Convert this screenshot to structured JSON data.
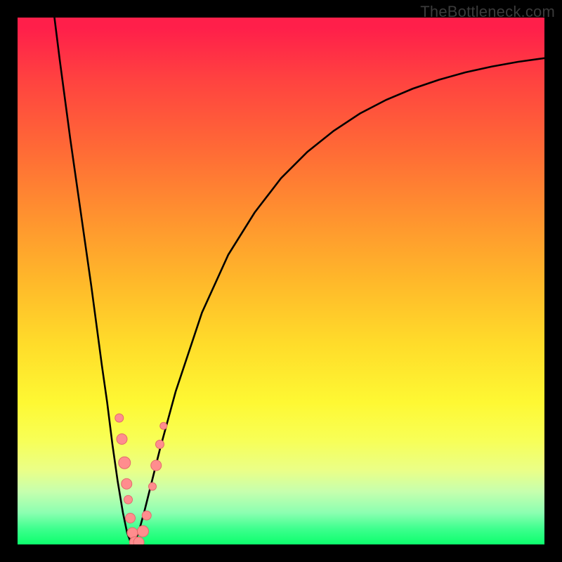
{
  "watermark": "TheBottleneck.com",
  "colors": {
    "curve": "#000000",
    "marker_fill": "#ff8d8e",
    "marker_stroke": "#e26b6b",
    "frame": "#000000"
  },
  "chart_data": {
    "type": "line",
    "title": "",
    "xlabel": "",
    "ylabel": "",
    "xlim": [
      0,
      100
    ],
    "ylim": [
      0,
      100
    ],
    "grid": false,
    "legend": false,
    "series": [
      {
        "name": "left-branch",
        "x": [
          7,
          8,
          10,
          12,
          14,
          16,
          17,
          18,
          19,
          20,
          20.8,
          21.4,
          22
        ],
        "y": [
          100,
          92,
          77,
          63,
          49,
          34,
          27,
          19,
          12,
          6,
          2.2,
          0.6,
          0
        ]
      },
      {
        "name": "right-branch",
        "x": [
          22,
          23,
          24,
          25,
          27,
          30,
          35,
          40,
          45,
          50,
          55,
          60,
          65,
          70,
          75,
          80,
          85,
          90,
          95,
          100
        ],
        "y": [
          0,
          2.4,
          6,
          10,
          18,
          29,
          44,
          55,
          63,
          69.5,
          74.5,
          78.5,
          81.8,
          84.4,
          86.5,
          88.2,
          89.6,
          90.7,
          91.6,
          92.3
        ]
      }
    ],
    "markers": {
      "name": "highlighted-points",
      "points": [
        {
          "x": 19.3,
          "y": 24.0,
          "r": 6.0
        },
        {
          "x": 19.8,
          "y": 20.0,
          "r": 7.5
        },
        {
          "x": 20.3,
          "y": 15.5,
          "r": 8.5
        },
        {
          "x": 20.7,
          "y": 11.5,
          "r": 7.5
        },
        {
          "x": 21.0,
          "y": 8.5,
          "r": 6.0
        },
        {
          "x": 21.4,
          "y": 5.0,
          "r": 7.0
        },
        {
          "x": 21.8,
          "y": 2.2,
          "r": 7.5
        },
        {
          "x": 22.3,
          "y": 0.4,
          "r": 8.0
        },
        {
          "x": 23.0,
          "y": 0.4,
          "r": 7.5
        },
        {
          "x": 23.8,
          "y": 2.5,
          "r": 8.0
        },
        {
          "x": 24.5,
          "y": 5.5,
          "r": 6.5
        },
        {
          "x": 25.6,
          "y": 11.0,
          "r": 5.5
        },
        {
          "x": 26.3,
          "y": 15.0,
          "r": 7.5
        },
        {
          "x": 27.0,
          "y": 19.0,
          "r": 6.0
        },
        {
          "x": 27.7,
          "y": 22.5,
          "r": 5.0
        }
      ]
    }
  }
}
